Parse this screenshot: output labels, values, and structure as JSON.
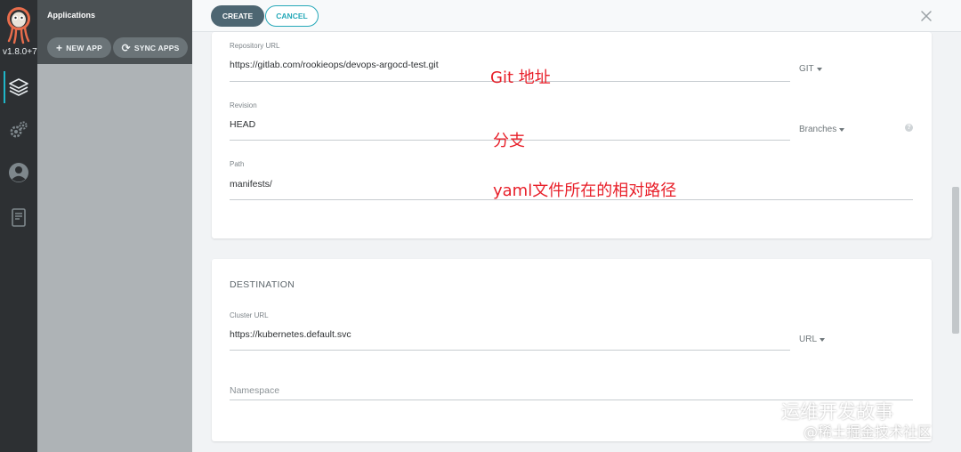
{
  "nav": {
    "version": "v1.8.0+7",
    "items": [
      {
        "icon": "layers-icon",
        "active": true
      },
      {
        "icon": "gear-icon",
        "active": false
      },
      {
        "icon": "user-icon",
        "active": false
      },
      {
        "icon": "docs-icon",
        "active": false
      }
    ]
  },
  "apps_panel": {
    "title": "Applications",
    "new_app_label": "NEW APP",
    "sync_apps_label": "SYNC APPS"
  },
  "toolbar": {
    "create_label": "CREATE",
    "cancel_label": "CANCEL",
    "close_icon": "close-icon"
  },
  "source": {
    "repo_url_label": "Repository URL",
    "repo_url_value": "https://gitlab.com/rookieops/devops-argocd-test.git",
    "repo_type": "GIT",
    "revision_label": "Revision",
    "revision_value": "HEAD",
    "revision_mode": "Branches",
    "path_label": "Path",
    "path_value": "manifests/"
  },
  "destination": {
    "title": "DESTINATION",
    "cluster_url_label": "Cluster URL",
    "cluster_url_value": "https://kubernetes.default.svc",
    "cluster_mode": "URL",
    "namespace_placeholder": "Namespace"
  },
  "annotations": {
    "git_address": "Git 地址",
    "branch": "分支",
    "yaml_path": "yaml文件所在的相对路径"
  },
  "watermark": {
    "line1": "运维开发故事",
    "line2": "@稀土掘金技术社区"
  },
  "colors": {
    "accent": "#25a8b8",
    "create_button": "#4d6672",
    "annotation": "#e8202a"
  }
}
